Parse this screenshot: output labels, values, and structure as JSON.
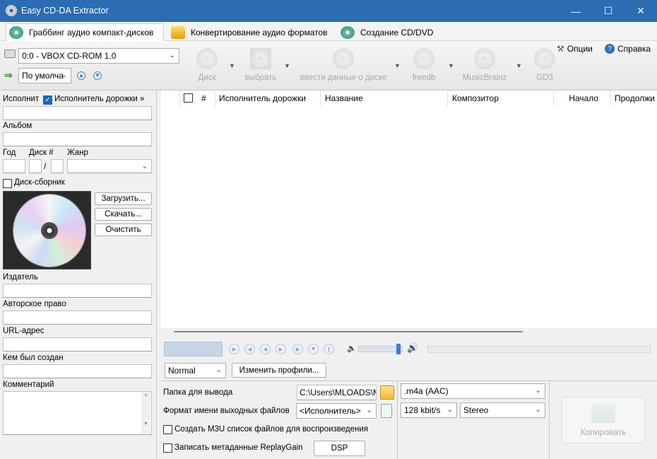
{
  "window": {
    "title": "Easy CD-DA Extractor",
    "minimize": "—",
    "maximize": "☐",
    "close": "✕"
  },
  "tabs": [
    {
      "label": "Граббинг аудио компакт-дисков"
    },
    {
      "label": "Конвертирование аудио форматов"
    },
    {
      "label": "Создание CD/DVD"
    }
  ],
  "toolbar": {
    "drive_value": "0:0 - VBOX CD-ROM 1.0",
    "profile_value": "По умолча",
    "disc": "Диск",
    "select": "выбрать",
    "enter_data": "ввести данные о диске",
    "freedb": "freedb",
    "musicbrainz": "MusicBrainz",
    "gd3": "GD3",
    "options": "Опции",
    "help": "Справка"
  },
  "left": {
    "artist_label": "Исполнит",
    "track_artist_label": "Исполнитель дорожки »",
    "album_label": "Альбом",
    "year_label": "Год",
    "disc_label": "Диск #",
    "slash": "/",
    "genre_label": "Жанр",
    "compilation_label": "Диск-сборник",
    "load_button": "Загрузить...",
    "download_button": "Скачать...",
    "clear_button": "Очистить",
    "publisher_label": "Издатель",
    "copyright_label": "Авторское право",
    "url_label": "URL-адрес",
    "created_by_label": "Кем был создан",
    "comment_label": "Комментарий"
  },
  "tracklist": {
    "columns": [
      "#",
      "Исполнитель дорожки",
      "Название",
      "Композитор",
      "Начало",
      "Продолжи"
    ]
  },
  "player": {
    "volume_level": 0.9
  },
  "bottom": {
    "quality": "Normal",
    "change_profiles": "Изменить профили...",
    "output_folder_label": "Папка для вывода",
    "output_folder_value": "C:\\Users\\MLOADS\\M",
    "filename_format_label": "Формат имени выходных файлов",
    "filename_format_value": "<Исполнитель>",
    "m3u_label": "Создать M3U список файлов для воспроизведения",
    "replaygain_label": "Записать метаданные ReplayGain",
    "dsp_button": "DSP",
    "format_value": ".m4a (AAC)",
    "bitrate_value": "128 kbit/s",
    "channels_value": "Stereo",
    "copy_button": "Копировать"
  }
}
